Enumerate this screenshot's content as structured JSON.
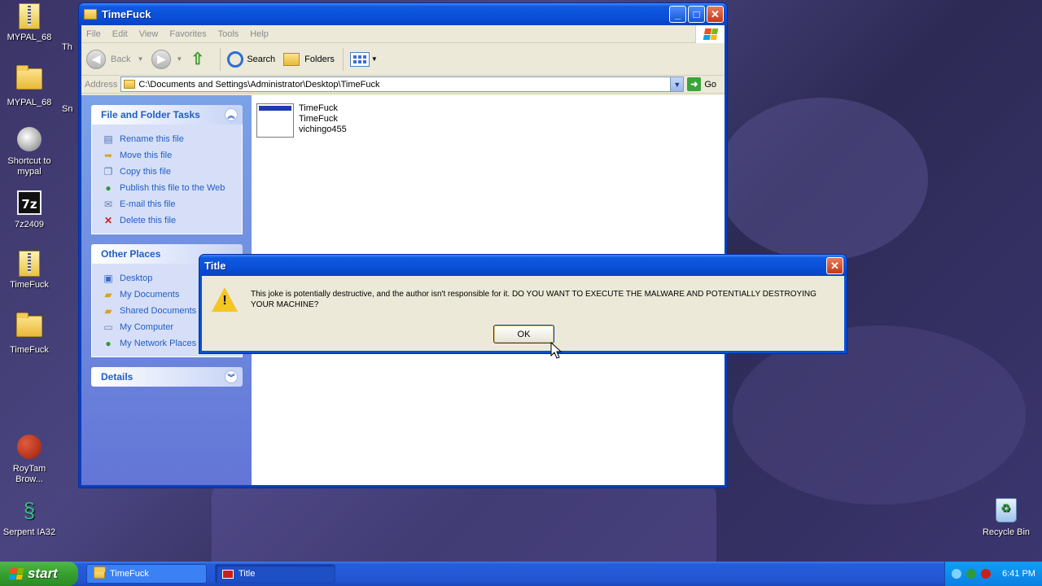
{
  "desktop": {
    "icons": [
      {
        "label": "MYPAL_68",
        "type": "zip"
      },
      {
        "label": "MYPAL_68",
        "type": "folder"
      },
      {
        "label": "Shortcut to mypal",
        "type": "shortcut"
      },
      {
        "label": "7z2409",
        "type": "7z"
      },
      {
        "label": "TimeFuck",
        "type": "zip"
      },
      {
        "label": "TimeFuck",
        "type": "folder"
      },
      {
        "label": "RoyTam Brow...",
        "type": "browser"
      },
      {
        "label": "Serpent IA32",
        "type": "serpent"
      },
      {
        "label": "Recycle Bin",
        "type": "recycle-bin"
      }
    ],
    "partial_labels": [
      "Th",
      "Sn"
    ]
  },
  "explorer": {
    "title": "TimeFuck",
    "menu": [
      "File",
      "Edit",
      "View",
      "Favorites",
      "Tools",
      "Help"
    ],
    "toolbar": {
      "back": "Back",
      "search": "Search",
      "folders": "Folders"
    },
    "address": {
      "label": "Address",
      "value": "C:\\Documents and Settings\\Administrator\\Desktop\\TimeFuck",
      "go": "Go"
    },
    "file_tasks": {
      "title": "File and Folder Tasks",
      "items": [
        "Rename this file",
        "Move this file",
        "Copy this file",
        "Publish this file to the Web",
        "E-mail this file",
        "Delete this file"
      ]
    },
    "other_places": {
      "title": "Other Places",
      "items": [
        "Desktop",
        "My Documents",
        "Shared Documents",
        "My Computer",
        "My Network Places"
      ]
    },
    "details": {
      "title": "Details"
    },
    "file": {
      "name": "TimeFuck",
      "description": "TimeFuck",
      "company": "vichingo455"
    }
  },
  "dialog": {
    "title": "Title",
    "message": "This joke is potentially destructive, and the author isn't responsible for it. DO YOU WANT TO EXECUTE THE MALWARE AND POTENTIALLY DESTROYING YOUR MACHINE?",
    "ok": "OK"
  },
  "taskbar": {
    "start": "start",
    "tasks": [
      {
        "label": "TimeFuck",
        "active": false
      },
      {
        "label": "Title",
        "active": true
      }
    ],
    "clock": "6:41 PM"
  },
  "colors": {
    "xp_blue": "#0a4fd8",
    "start_green": "#36a02f",
    "taskpane_link": "#215dc6",
    "warning_yellow": "#f3c623"
  }
}
